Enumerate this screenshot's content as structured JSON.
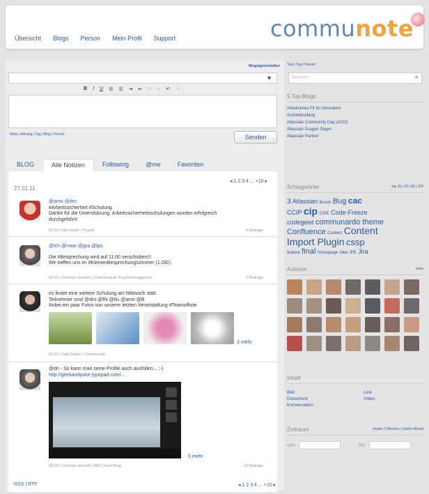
{
  "header": {
    "nav": [
      "Übersicht",
      "Blogs",
      "Person",
      "Mein Profil",
      "Support"
    ],
    "logo_a": "commu",
    "logo_b": "note"
  },
  "editor": {
    "blog_props": "Blogeigenschaften",
    "links": "Notiz | Anhang | Tag | Blog | Person",
    "send": "Senden"
  },
  "tabs": [
    "BLOG",
    "Alle Notizen",
    "Following",
    "@me",
    "Favoriten"
  ],
  "feed": {
    "date": "27.01.11",
    "pagination": "◂ 1 2 3 4 ... +10 ▸",
    "posts": [
      {
        "line1": "@amo @dro",
        "line2": "#Arbeitssicherheit #Schulung",
        "line3": "Danke für die Unterstützung. Arbeitssicherheitsschulungen wurden erfolgreich",
        "line4": "durchgeführt!",
        "meta": "09:30 | Elja Haußl | Projekt",
        "count": "4 Beiträge"
      },
      {
        "line1": "@lch @mwe @gra @lpo",
        "line2": "Die #Besprechung wird auf 11:00 verschoben!!!",
        "line3": "Wir treffen uns im #KleinenBesprechungszimmer (1.OG).",
        "meta": "09:25 | Christian Heindel | Communardo Projektmanagement",
        "count": "2 Beiträge"
      },
      {
        "line1": "es findet eine weitere Schulung am Mittwoch statt.",
        "line2": "Teilnehmer sind @dro @fhi @tlu @amo @lli",
        "line3": "Anbei ein paar Fotos von unserer letzten Veranstaltung #Teamoffsite",
        "more": "3 mehr",
        "meta": "09:13 | Falk Gabler | Communote"
      },
      {
        "line1": "@dri - So kann man seine Profile auch ausfüllen... ;-)",
        "line2": "http://geekandpoke.typepad.com/...",
        "more": "5 mehr",
        "meta": "09:09 | Christian Heindel | MES Team Blog",
        "count": "12 Beiträge"
      }
    ]
  },
  "footer": {
    "rss": "RSS | RTF"
  },
  "right": {
    "filter": "Text | Tag | Person",
    "search_ph": "Suchen",
    "top_blogs_title": "5 Top Blogs",
    "top_blogs": [
      "Arbeitskreis Fit für Innovation",
      "Architekturblog",
      "Atlassian Community Day (ACD)",
      "Atlassian Dragon Slayer",
      "Atlassian Partner"
    ],
    "tags_title": "Schlagwörter",
    "tags_top": "top 10 | 20 | 50 | 100",
    "authors_title": "Autoren",
    "authors_more": "more",
    "content_title": "Inhalt",
    "content": [
      "Bild",
      "Link",
      "Dokument",
      "Video",
      "Konversation",
      ""
    ],
    "period_title": "Zeitraum",
    "period_opts": "letzten 2 Wochen | letzten Monat",
    "from": "von",
    "to": "bis"
  }
}
